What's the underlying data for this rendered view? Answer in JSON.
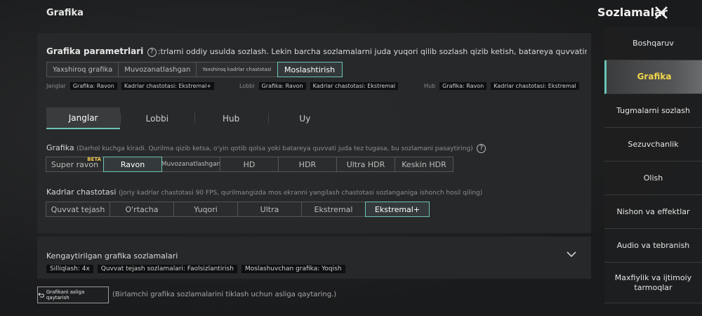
{
  "header": {
    "title": "Grafika",
    "settings_title": "Sozlamalar"
  },
  "graphics_params": {
    "label": "Grafika parametrlari",
    "description": ":trlarni oddiy usulda sozlash. Lekin barcha sozlamalarni juda yuqori qilib sozlash qizib ketish, batareya quvvatining tugashi yoki beqaror geympley kabi un",
    "presets": [
      "Yaxshiroq grafika",
      "Muvozanatlashgan",
      "Yaxshiroq kadrlar chastotasi",
      "Moslashtirish"
    ],
    "summaries": [
      {
        "scope": "Janglar",
        "graphics": "Grafika: Ravon",
        "fps": "Kadrlar chastotasi: Ekstremal+"
      },
      {
        "scope": "Lobbi",
        "graphics": "Grafika: Ravon",
        "fps": "Kadrlar chastotasi: Ekstremal"
      },
      {
        "scope": "Hub",
        "graphics": "Grafika: Ravon",
        "fps": "Kadrlar chastotasi: Ekstremal"
      }
    ]
  },
  "tabs": [
    "Janglar",
    "Lobbi",
    "Hub",
    "Uy"
  ],
  "graphics": {
    "label": "Grafika",
    "note": "(Darhol kuchga kiradi. Qurilma qizib ketsa, o'yin qotib qolsa yoki batareya quvvati juda tez tugasa, bu sozlamani pasaytiring)",
    "options": [
      "Super ravon",
      "Ravon",
      "Muvozanatlashgan",
      "HD",
      "HDR",
      "Ultra HDR",
      "Keskin HDR"
    ],
    "beta_badge": "BETA",
    "selected": "Ravon"
  },
  "fps": {
    "label": "Kadrlar chastotasi",
    "note": "(Joriy kadrlar chastotasi 90 FPS, qurilmangizda mos ekranni yangilash chastotasi sozlanganiga ishonch hosil qiling)",
    "options": [
      "Quvvat tejash",
      "O'rtacha",
      "Yuqori",
      "Ultra",
      "Ekstremal",
      "Ekstremal+"
    ],
    "selected": "Ekstremal+"
  },
  "advanced": {
    "label": "Kengaytirilgan grafika sozlamalari",
    "chips": [
      "Silliqlash: 4x",
      "Quvvat tejash sozlamalari: Faolsizlantirish",
      "Moslashuvchan grafika: Yoqish"
    ]
  },
  "reset": {
    "button": "Grafikani asliga qaytarish",
    "note": "(Birlamchi grafika sozlamalarini tiklash uchun asliga qaytaring.)"
  },
  "sidebar": {
    "items": [
      "Boshqaruv",
      "Grafika",
      "Tugmalarni sozlash",
      "Sezuvchanlik",
      "Olish",
      "Nishon va effektlar",
      "Audio va tebranish",
      "Maxfiylik va ijtimoiy tarmoqlar"
    ],
    "active": "Grafika"
  },
  "colors": {
    "accent": "#6bc3b7",
    "active_sidebar_text": "#f2d64b",
    "beta": "#f2c94c"
  }
}
